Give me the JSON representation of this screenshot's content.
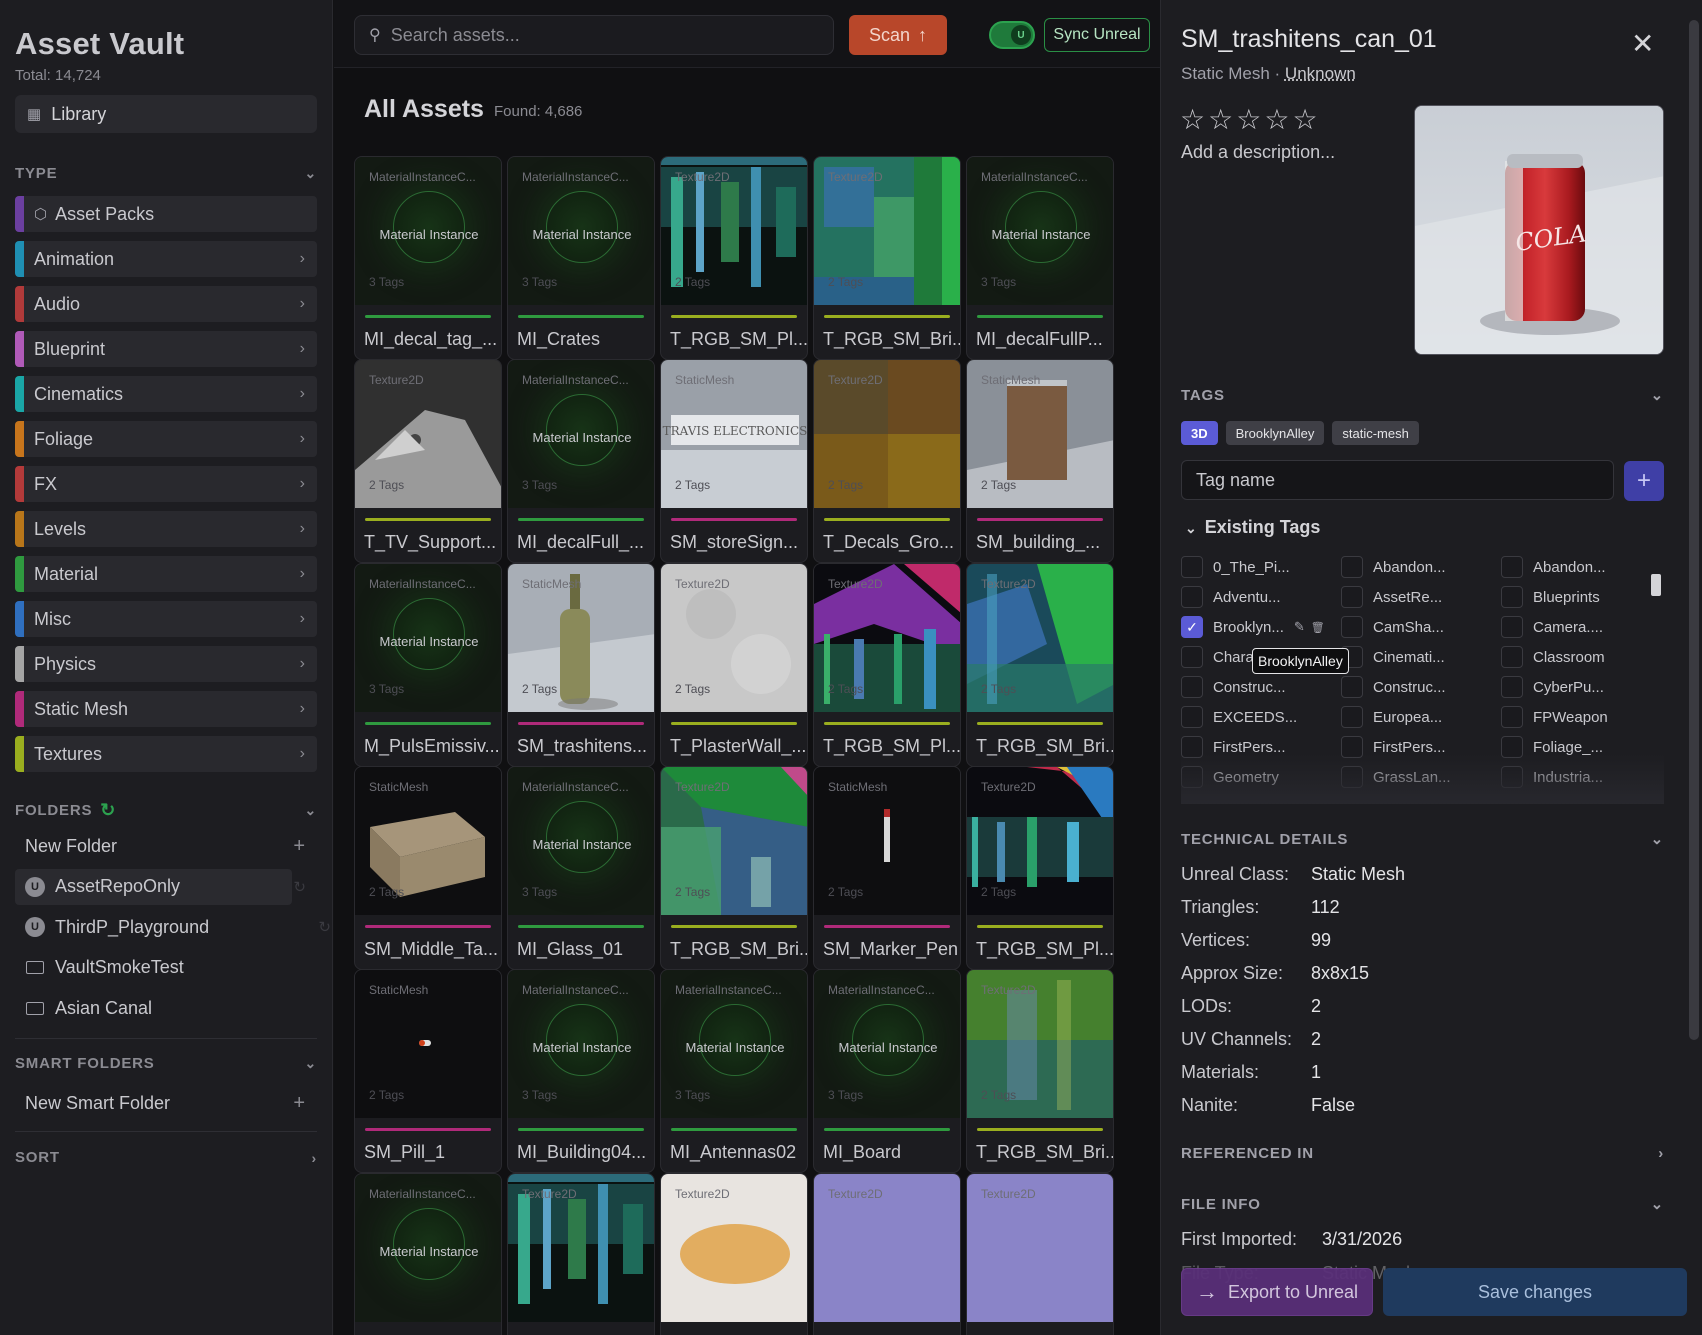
{
  "sidebar": {
    "app_title": "Asset Vault",
    "total": "Total: 14,724",
    "library_label": "Library",
    "type_header": "TYPE",
    "types": [
      {
        "label": "Asset Packs",
        "color": "#6b3fa0",
        "expandable": false
      },
      {
        "label": "Animation",
        "color": "#1f8fb3",
        "expandable": true
      },
      {
        "label": "Audio",
        "color": "#b03a3a",
        "expandable": true
      },
      {
        "label": "Blueprint",
        "color": "#b05ab8",
        "expandable": true
      },
      {
        "label": "Cinematics",
        "color": "#1aa6a6",
        "expandable": true
      },
      {
        "label": "Foliage",
        "color": "#c7751c",
        "expandable": true
      },
      {
        "label": "FX",
        "color": "#b33a3a",
        "expandable": true
      },
      {
        "label": "Levels",
        "color": "#b8761a",
        "expandable": true
      },
      {
        "label": "Material",
        "color": "#2f9a3f",
        "expandable": true
      },
      {
        "label": "Misc",
        "color": "#2f6fbf",
        "expandable": true
      },
      {
        "label": "Physics",
        "color": "#a5a5a5",
        "expandable": true
      },
      {
        "label": "Static Mesh",
        "color": "#b02a7a",
        "expandable": true
      },
      {
        "label": "Textures",
        "color": "#9aae1f",
        "expandable": true
      }
    ],
    "folders_header": "FOLDERS",
    "folders": [
      {
        "label": "New Folder",
        "kind": "new"
      },
      {
        "label": "AssetRepoOnly",
        "kind": "unreal",
        "active": true
      },
      {
        "label": "ThirdP_Playground",
        "kind": "unreal"
      },
      {
        "label": "VaultSmokeTest",
        "kind": "folder"
      },
      {
        "label": "Asian Canal",
        "kind": "folder"
      }
    ],
    "smart_folders_header": "SMART FOLDERS",
    "new_smart_folder": "New Smart Folder",
    "sort_header": "SORT"
  },
  "topbar": {
    "search_placeholder": "Search assets...",
    "scan_label": "Scan",
    "sync_label": "Sync Unreal"
  },
  "grid": {
    "title": "All Assets",
    "found": "Found: 4,686",
    "cards": [
      {
        "type": "MaterialInstanceC...",
        "tags": "3 Tags",
        "name": "MI_decal_tag_...",
        "kind": "mi",
        "line": "#2f9a3f"
      },
      {
        "type": "MaterialInstanceC...",
        "tags": "3 Tags",
        "name": "MI_Crates",
        "kind": "mi",
        "line": "#2f9a3f"
      },
      {
        "type": "Texture2D",
        "tags": "2 Tags",
        "name": "T_RGB_SM_Pl...",
        "kind": "noise1",
        "line": "#9aae1f"
      },
      {
        "type": "Texture2D",
        "tags": "2 Tags",
        "name": "T_RGB_SM_Bri...",
        "kind": "noise2",
        "line": "#9aae1f"
      },
      {
        "type": "MaterialInstanceC...",
        "tags": "3 Tags",
        "name": "MI_decalFullP...",
        "kind": "mi",
        "line": "#2f9a3f"
      },
      {
        "type": "Texture2D",
        "tags": "2 Tags",
        "name": "T_TV_Support...",
        "kind": "tv",
        "line": "#9aae1f"
      },
      {
        "type": "MaterialInstanceC...",
        "tags": "3 Tags",
        "name": "MI_decalFull_...",
        "kind": "mi",
        "line": "#2f9a3f"
      },
      {
        "type": "StaticMesh",
        "tags": "2 Tags",
        "name": "SM_storeSign...",
        "kind": "sign",
        "line": "#b02a7a"
      },
      {
        "type": "Texture2D",
        "tags": "2 Tags",
        "name": "T_Decals_Gro...",
        "kind": "decal",
        "line": "#9aae1f"
      },
      {
        "type": "StaticMesh",
        "tags": "2 Tags",
        "name": "SM_building_...",
        "kind": "building",
        "line": "#b02a7a"
      },
      {
        "type": "MaterialInstanceC...",
        "tags": "3 Tags",
        "name": "M_PulsEmissiv...",
        "kind": "mi",
        "line": "#2f9a3f"
      },
      {
        "type": "StaticMesh",
        "tags": "2 Tags",
        "name": "SM_trashitens...",
        "kind": "bottle",
        "line": "#b02a7a"
      },
      {
        "type": "Texture2D",
        "tags": "2 Tags",
        "name": "T_PlasterWall_...",
        "kind": "plaster",
        "line": "#9aae1f"
      },
      {
        "type": "Texture2D",
        "tags": "2 Tags",
        "name": "T_RGB_SM_Pl...",
        "kind": "noise3",
        "line": "#9aae1f"
      },
      {
        "type": "Texture2D",
        "tags": "2 Tags",
        "name": "T_RGB_SM_Bri...",
        "kind": "noise4",
        "line": "#9aae1f"
      },
      {
        "type": "StaticMesh",
        "tags": "2 Tags",
        "name": "SM_Middle_Ta...",
        "kind": "box",
        "line": "#b02a7a"
      },
      {
        "type": "MaterialInstanceC...",
        "tags": "3 Tags",
        "name": "MI_Glass_01",
        "kind": "mi",
        "line": "#2f9a3f"
      },
      {
        "type": "Texture2D",
        "tags": "2 Tags",
        "name": "T_RGB_SM_Bri...",
        "kind": "noise5",
        "line": "#9aae1f"
      },
      {
        "type": "StaticMesh",
        "tags": "2 Tags",
        "name": "SM_Marker_Pen",
        "kind": "pen",
        "line": "#b02a7a"
      },
      {
        "type": "Texture2D",
        "tags": "2 Tags",
        "name": "T_RGB_SM_Pl...",
        "kind": "noise6",
        "line": "#9aae1f"
      },
      {
        "type": "StaticMesh",
        "tags": "2 Tags",
        "name": "SM_Pill_1",
        "kind": "pill",
        "line": "#b02a7a"
      },
      {
        "type": "MaterialInstanceC...",
        "tags": "3 Tags",
        "name": "MI_Building04...",
        "kind": "mi",
        "line": "#2f9a3f"
      },
      {
        "type": "MaterialInstanceC...",
        "tags": "3 Tags",
        "name": "MI_Antennas02",
        "kind": "mi",
        "line": "#2f9a3f"
      },
      {
        "type": "MaterialInstanceC...",
        "tags": "3 Tags",
        "name": "MI_Board",
        "kind": "mi",
        "line": "#2f9a3f"
      },
      {
        "type": "Texture2D",
        "tags": "2 Tags",
        "name": "T_RGB_SM_Bri...",
        "kind": "noise7",
        "line": "#9aae1f"
      },
      {
        "type": "MaterialInstanceC...",
        "tags": "",
        "name": "",
        "kind": "mi",
        "line": ""
      },
      {
        "type": "Texture2D",
        "tags": "",
        "name": "",
        "kind": "noise1",
        "line": ""
      },
      {
        "type": "Texture2D",
        "tags": "",
        "name": "",
        "kind": "orange",
        "line": ""
      },
      {
        "type": "Texture2D",
        "tags": "",
        "name": "",
        "kind": "lilac",
        "line": ""
      },
      {
        "type": "Texture2D",
        "tags": "",
        "name": "",
        "kind": "lilac",
        "line": ""
      }
    ],
    "mi_label": "Material Instance"
  },
  "panel": {
    "title": "SM_trashitens_can_01",
    "subtitle_type": "Static Mesh",
    "subtitle_sep": " · ",
    "subtitle_source": "Unknown",
    "rating": 0,
    "rating_max": 5,
    "description_placeholder": "Add a description...",
    "preview_label": "COLA",
    "tags_header": "TAGS",
    "tags": [
      "3D",
      "BrooklynAlley",
      "static-mesh"
    ],
    "tag_input_placeholder": "Tag name",
    "existing_header": "Existing Tags",
    "existing_tags": [
      {
        "label": "0_The_Pi...",
        "checked": false
      },
      {
        "label": "Abandon...",
        "checked": false
      },
      {
        "label": "Abandon...",
        "checked": false
      },
      {
        "label": "Adventu...",
        "checked": false
      },
      {
        "label": "AssetRe...",
        "checked": false
      },
      {
        "label": "Blueprints",
        "checked": false
      },
      {
        "label": "Brooklyn...",
        "checked": true
      },
      {
        "label": "CamSha...",
        "checked": false
      },
      {
        "label": "Camera....",
        "checked": false
      },
      {
        "label": "Chara",
        "checked": false
      },
      {
        "label": "Cinemati...",
        "checked": false
      },
      {
        "label": "Classroom",
        "checked": false
      },
      {
        "label": "Construc...",
        "checked": false
      },
      {
        "label": "Construc...",
        "checked": false
      },
      {
        "label": "CyberPu...",
        "checked": false
      },
      {
        "label": "EXCEEDS...",
        "checked": false
      },
      {
        "label": "Europea...",
        "checked": false
      },
      {
        "label": "FPWeapon",
        "checked": false
      },
      {
        "label": "FirstPers...",
        "checked": false
      },
      {
        "label": "FirstPers...",
        "checked": false
      },
      {
        "label": "Foliage_...",
        "checked": false
      },
      {
        "label": "Geometry",
        "checked": false
      },
      {
        "label": "GrassLan...",
        "checked": false
      },
      {
        "label": "Industria...",
        "checked": false
      }
    ],
    "tooltip": "BrooklynAlley",
    "tech_header": "TECHNICAL DETAILS",
    "tech": [
      {
        "k": "Unreal Class:",
        "v": "Static Mesh"
      },
      {
        "k": "Triangles:",
        "v": "112"
      },
      {
        "k": "Vertices:",
        "v": "99"
      },
      {
        "k": "Approx Size:",
        "v": "8x8x15"
      },
      {
        "k": "LODs:",
        "v": "2"
      },
      {
        "k": "UV Channels:",
        "v": "2"
      },
      {
        "k": "Materials:",
        "v": "1"
      },
      {
        "k": "Nanite:",
        "v": "False"
      }
    ],
    "referenced_header": "REFERENCED IN",
    "fileinfo_header": "FILE INFO",
    "first_imported_k": "First Imported:",
    "first_imported_v": "3/31/2026",
    "file_type_k": "File Type:",
    "file_type_v": "Static Mesh",
    "export_label": "Export to Unreal",
    "save_label": "Save changes"
  }
}
